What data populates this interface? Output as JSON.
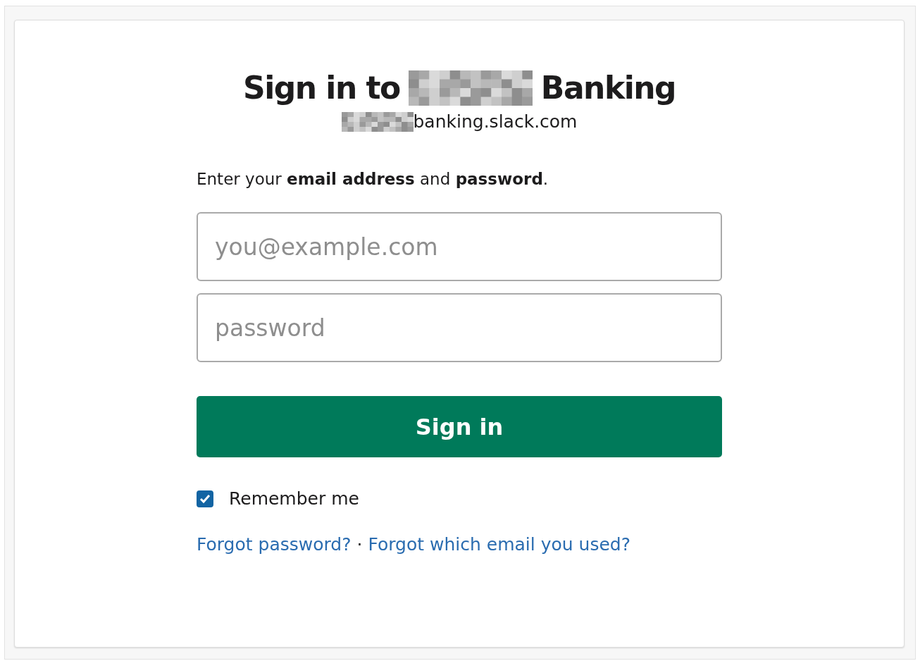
{
  "heading": {
    "before": "Sign in to",
    "redacted": true,
    "after": "Banking"
  },
  "workspace_url": {
    "redacted": true,
    "text": "banking.slack.com"
  },
  "instruction": "Enter your **email address** and **password**.",
  "email_field": {
    "placeholder": "you@example.com"
  },
  "password_field": {
    "placeholder": "password"
  },
  "sign_in_button": "Sign in",
  "remember": {
    "label": "Remember me",
    "checked": true
  },
  "links": [
    {
      "text": "Forgot password?"
    },
    {
      "text": "Forgot which email you used?"
    }
  ],
  "link_separator": "·"
}
